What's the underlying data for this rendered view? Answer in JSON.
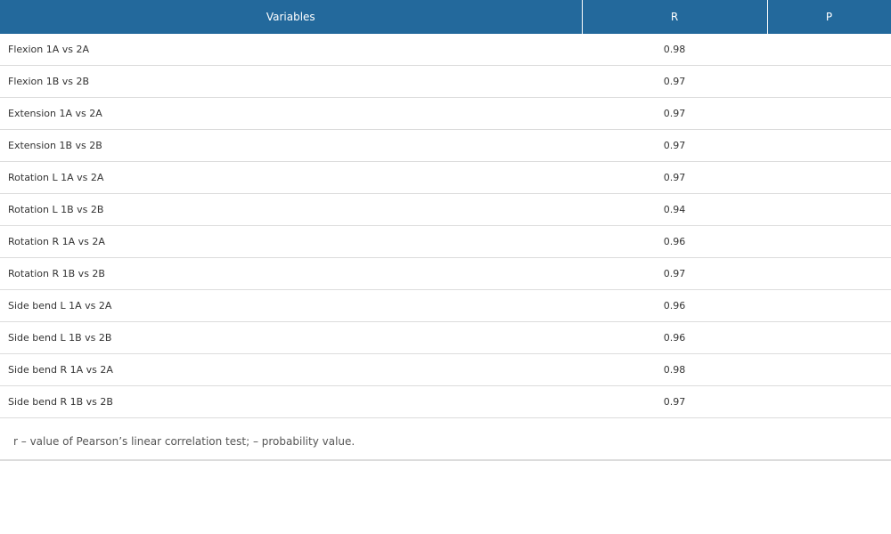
{
  "table": {
    "headers": [
      "Variables",
      "R",
      "P"
    ],
    "rows": [
      {
        "variable": "Flexion 1A vs 2A",
        "r": "0.98",
        "p": ""
      },
      {
        "variable": "Flexion 1B vs 2B",
        "r": "0.97",
        "p": ""
      },
      {
        "variable": "Extension 1A vs 2A",
        "r": "0.97",
        "p": ""
      },
      {
        "variable": "Extension 1B vs 2B",
        "r": "0.97",
        "p": ""
      },
      {
        "variable": "Rotation L 1A vs 2A",
        "r": "0.97",
        "p": ""
      },
      {
        "variable": "Rotation L 1B vs 2B",
        "r": "0.94",
        "p": ""
      },
      {
        "variable": "Rotation R 1A vs 2A",
        "r": "0.96",
        "p": ""
      },
      {
        "variable": "Rotation R 1B vs 2B",
        "r": "0.97",
        "p": ""
      },
      {
        "variable": "Side bend L 1A vs 2A",
        "r": "0.96",
        "p": ""
      },
      {
        "variable": "Side bend L 1B vs 2B",
        "r": "0.96",
        "p": ""
      },
      {
        "variable": "Side bend R 1A vs 2A",
        "r": "0.98",
        "p": ""
      },
      {
        "variable": "Side bend R 1B vs 2B",
        "r": "0.97",
        "p": ""
      }
    ],
    "footnote": "r – value of Pearson’s linear correlation test; – probability value."
  },
  "colors": {
    "header_bg": "#23699c",
    "header_text": "#ffffff",
    "row_border": "#dcdcdc"
  }
}
